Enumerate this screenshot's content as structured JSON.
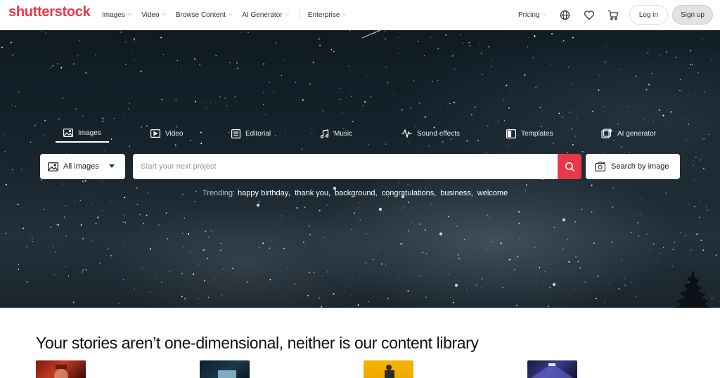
{
  "header": {
    "logo": "shutterstock",
    "nav": [
      {
        "label": "Images"
      },
      {
        "label": "Video"
      },
      {
        "label": "Browse Content"
      },
      {
        "label": "AI Generator"
      },
      {
        "label": "Enterprise"
      }
    ],
    "pricing": "Pricing",
    "login": "Log in",
    "signup": "Sign up",
    "icons": [
      "globe-icon",
      "heart-icon",
      "cart-icon"
    ]
  },
  "hero": {
    "tabs": [
      {
        "label": "Images",
        "icon": "image-icon",
        "active": true
      },
      {
        "label": "Video",
        "icon": "play-icon"
      },
      {
        "label": "Editorial",
        "icon": "newspaper-icon"
      },
      {
        "label": "Music",
        "icon": "music-note-icon"
      },
      {
        "label": "Sound effects",
        "icon": "waveform-icon"
      },
      {
        "label": "Templates",
        "icon": "template-icon"
      },
      {
        "label": "AI generator",
        "icon": "ai-sparkle-icon"
      }
    ],
    "search": {
      "type_label": "All images",
      "placeholder": "Start your next project",
      "value": "",
      "image_search_label": "Search by image"
    },
    "trending": {
      "label": "Trending:",
      "terms": [
        "happy birthday",
        "thank you",
        "background",
        "congratulations",
        "business",
        "welcome"
      ]
    }
  },
  "content": {
    "title": "Your stories aren’t one-dimensional, neither is our content library"
  },
  "colors": {
    "brand": "#e8384a",
    "hero_bg": "#17242d"
  }
}
